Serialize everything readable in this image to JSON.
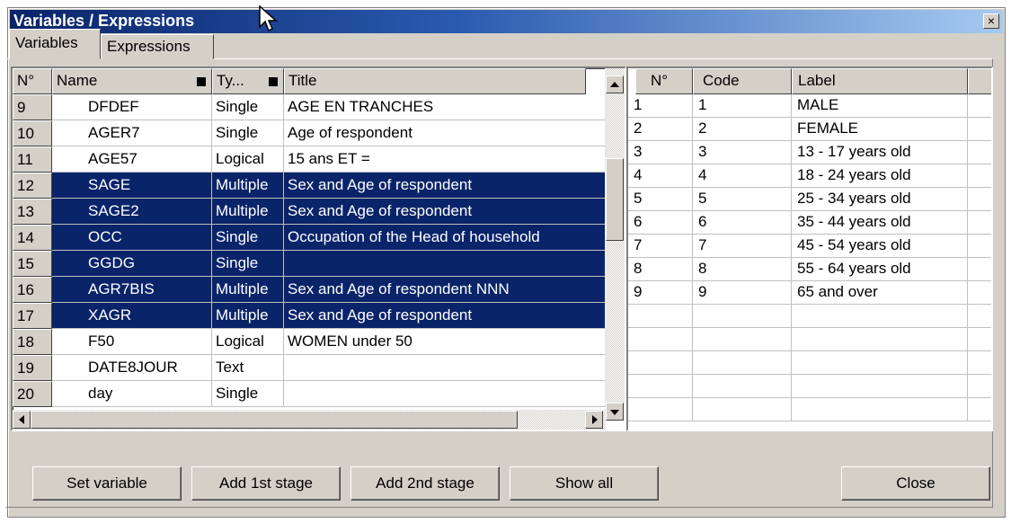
{
  "window": {
    "title": "Variables / Expressions",
    "close_glyph": "×"
  },
  "tabs": [
    {
      "label": "Variables"
    },
    {
      "label": "Expressions"
    }
  ],
  "variables_table": {
    "headers": {
      "num": "N°",
      "name": "Name",
      "type": "Ty...",
      "title": "Title"
    },
    "rows": [
      {
        "num": "9",
        "name": "DFDEF",
        "type": "Single",
        "title": "AGE EN TRANCHES",
        "selected": false
      },
      {
        "num": "10",
        "name": "AGER7",
        "type": "Single",
        "title": "Age of respondent",
        "selected": false
      },
      {
        "num": "11",
        "name": "AGE57",
        "type": "Logical",
        "title": "15 ans ET =",
        "selected": false
      },
      {
        "num": "12",
        "name": "SAGE",
        "type": "Multiple",
        "title": "Sex and Age of respondent",
        "selected": true
      },
      {
        "num": "13",
        "name": "SAGE2",
        "type": "Multiple",
        "title": "Sex and Age of respondent",
        "selected": true
      },
      {
        "num": "14",
        "name": "OCC",
        "type": "Single",
        "title": "Occupation of the Head of household",
        "selected": true
      },
      {
        "num": "15",
        "name": "GGDG",
        "type": "Single",
        "title": "",
        "selected": true
      },
      {
        "num": "16",
        "name": "AGR7BIS",
        "type": "Multiple",
        "title": "Sex and Age of respondent   NNN",
        "selected": true
      },
      {
        "num": "17",
        "name": "XAGR",
        "type": "Multiple",
        "title": "Sex and Age of respondent",
        "selected": true
      },
      {
        "num": "18",
        "name": "F50",
        "type": "Logical",
        "title": "WOMEN under 50",
        "selected": false
      },
      {
        "num": "19",
        "name": "DATE8JOUR",
        "type": "Text",
        "title": "",
        "selected": false
      },
      {
        "num": "20",
        "name": "day",
        "type": "Single",
        "title": "",
        "selected": false
      }
    ]
  },
  "codes_table": {
    "headers": {
      "num": "N°",
      "code": "Code",
      "label": "Label"
    },
    "rows": [
      {
        "num": "1",
        "code": "1",
        "label": "MALE"
      },
      {
        "num": "2",
        "code": "2",
        "label": "FEMALE"
      },
      {
        "num": "3",
        "code": "3",
        "label": "13 - 17 years old"
      },
      {
        "num": "4",
        "code": "4",
        "label": "18 - 24 years old"
      },
      {
        "num": "5",
        "code": "5",
        "label": "25 - 34 years old"
      },
      {
        "num": "6",
        "code": "6",
        "label": "35 - 44 years old"
      },
      {
        "num": "7",
        "code": "7",
        "label": "45 - 54 years old"
      },
      {
        "num": "8",
        "code": "8",
        "label": "55 - 64 years old"
      },
      {
        "num": "9",
        "code": "9",
        "label": "65 and over"
      }
    ]
  },
  "buttons": {
    "set_variable": "Set variable",
    "add_1st_stage": "Add 1st stage",
    "add_2nd_stage": "Add 2nd stage",
    "show_all": "Show all",
    "close": "Close"
  },
  "colors": {
    "title_bar": "#0a246a",
    "selection": "#0a246a",
    "face": "#d4d0c8"
  }
}
